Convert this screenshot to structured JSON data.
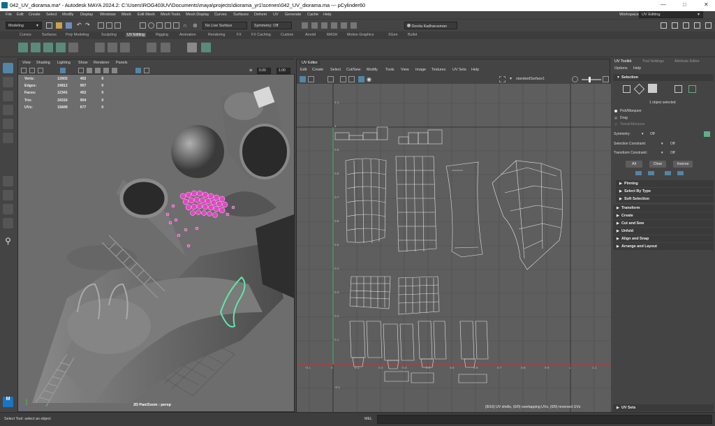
{
  "window": {
    "title": "042_UV_diorama.ma* - Autodesk MAYA 2024.2: C:\\Users\\ROG403UV\\Documents\\maya\\projects\\diorama_yr1\\scenes\\042_UV_diorama.ma  ---  pCylinder60"
  },
  "menubar": {
    "items": [
      "File",
      "Edit",
      "Create",
      "Select",
      "Modify",
      "Display",
      "Windows",
      "Mesh",
      "Edit Mesh",
      "Mesh Tools",
      "Mesh Display",
      "Curves",
      "Surfaces",
      "Deform",
      "UV",
      "Generate",
      "Cache",
      "Help"
    ],
    "workspace_label": "Workspace:",
    "workspace_value": "UV Editing"
  },
  "statusline": {
    "mode": "Modeling",
    "live_surface": "No Live Surface",
    "symmetry": "Symmetry: Off",
    "user": "Donita Kadharusman"
  },
  "shelf_tabs": [
    "Curves",
    "Surfaces",
    "Poly Modeling",
    "Sculpting",
    "UV Editing",
    "Rigging",
    "Animation",
    "Rendering",
    "FX",
    "FX Caching",
    "Custom",
    "Arnold",
    "MASH",
    "Motion Graphics",
    "XGen",
    "Bullet"
  ],
  "shelf_active": "UV Editing",
  "viewport": {
    "menu": [
      "View",
      "Shading",
      "Lighting",
      "Show",
      "Renderer",
      "Panels"
    ],
    "field1": "0.00",
    "field2": "1.00",
    "hud": [
      {
        "label": "Verts:",
        "a": "12602",
        "b": "452",
        "c": "0"
      },
      {
        "label": "Edges:",
        "a": "24812",
        "b": "907",
        "c": "0"
      },
      {
        "label": "Faces:",
        "a": "12341",
        "b": "452",
        "c": "0"
      },
      {
        "label": "Tris:",
        "a": "24316",
        "b": "904",
        "c": "0"
      },
      {
        "label": "UVs:",
        "a": "15849",
        "b": "677",
        "c": "0"
      }
    ],
    "camera_label": "2D Pan/Zoom : persp"
  },
  "uv_editor": {
    "panel_title": "UV Editor",
    "menu": [
      "Edit",
      "Create",
      "Select",
      "Cut/Sew",
      "Modify",
      "Tools",
      "View",
      "Image",
      "Textures",
      "UV Sets",
      "Help"
    ],
    "shader_name": "standardSurface1",
    "axis_labels_u": [
      "-0.1",
      "0",
      "0.1",
      "0.2",
      "0.3",
      "0.4",
      "0.5",
      "0.6",
      "0.7",
      "0.8",
      "0.9",
      "1",
      "1.1"
    ],
    "axis_labels_v": [
      "1.1",
      "1",
      "0.9",
      "0.8",
      "0.7",
      "0.6",
      "0.5",
      "0.4",
      "0.3",
      "0.2",
      "0.1",
      "-0.1"
    ],
    "status": "(8/16) UV shells, (0/0) overlapping UVs, (0/0) reversed UVs"
  },
  "attr_panel": {
    "tabs": [
      "UV Toolkit",
      "Tool Settings",
      "Attribute Editor"
    ],
    "menu": [
      "Options",
      "Help"
    ],
    "selection_header": "Selection",
    "selected_info": "1 object selected",
    "radio": [
      "Pick/Marquee",
      "Drag",
      "Tweak/Marquee"
    ],
    "symmetry_label": "Symmetry:",
    "symmetry_value": "Off",
    "sel_constraint_label": "Selection Constraint:",
    "sel_constraint_value": "Off",
    "xform_constraint_label": "Transform Constraint:",
    "xform_constraint_value": "Off",
    "buttons": [
      "All",
      "Clear",
      "Inverse"
    ],
    "subsections": [
      "Pinning",
      "Select By Type",
      "Soft Selection"
    ],
    "sections": [
      "Transform",
      "Create",
      "Cut and Sew",
      "Unfold",
      "Align and Snap",
      "Arrange and Layout"
    ],
    "uv_sets": "UV Sets"
  },
  "helpline": {
    "text": "Select Tool: select an object",
    "mel": "MEL"
  },
  "colors": {
    "accent": "#5285a6",
    "selection_pink": "#e844c8",
    "uv_wire": "#e6e6e6",
    "uv_bg": "#5e5e5e",
    "v_axis": "#3cb45a",
    "u_axis": "#c83232"
  }
}
